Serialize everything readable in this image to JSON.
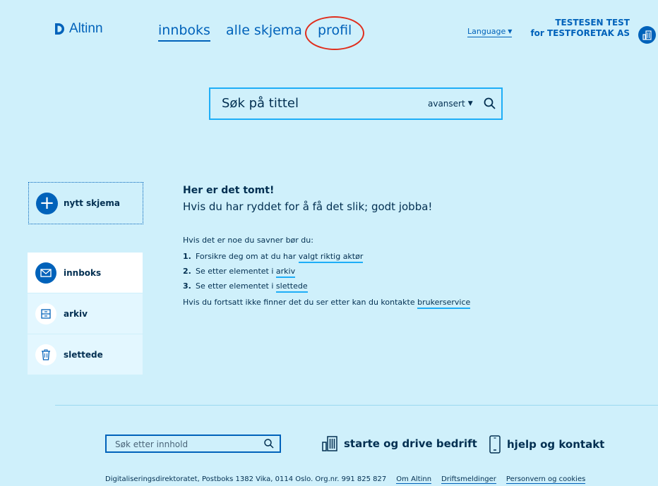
{
  "header": {
    "logo_text": "Altinn",
    "nav": [
      {
        "label": "innboks"
      },
      {
        "label": "alle skjema"
      },
      {
        "label": "profil"
      }
    ],
    "language_label": "Language",
    "user_name": "TESTESEN TEST",
    "user_org": "for TESTFORETAK AS"
  },
  "search": {
    "placeholder": "Søk på tittel",
    "advanced_label": "avansert"
  },
  "sidebar": {
    "new_form_label": "nytt skjema",
    "items": [
      {
        "label": "innboks",
        "icon": "envelope-icon"
      },
      {
        "label": "arkiv",
        "icon": "archive-icon"
      },
      {
        "label": "slettede",
        "icon": "trash-icon"
      }
    ]
  },
  "main": {
    "title": "Her er det tomt!",
    "subtitle": "Hvis du har ryddet for å få det slik; godt jobba!",
    "intro": "Hvis det er noe du savner bør du:",
    "steps": [
      {
        "num": "1.",
        "text": "Forsikre deg om at du har ",
        "link": "valgt riktig aktør"
      },
      {
        "num": "2.",
        "text": "Se etter elementet i ",
        "link": "arkiv"
      },
      {
        "num": "3.",
        "text": "Se etter elementet i ",
        "link": "slettede"
      }
    ],
    "outro_text": "Hvis du fortsatt ikke finner det du ser etter kan du kontakte ",
    "outro_link": "brukerservice"
  },
  "footer": {
    "search_placeholder": "Søk etter innhold",
    "link_business": "starte og drive bedrift",
    "link_help": "hjelp og kontakt",
    "address": "Digitaliseringsdirektoratet, Postboks 1382 Vika, 0114 Oslo. Org.nr. 991 825 827",
    "links": [
      "Om Altinn",
      "Driftsmeldinger",
      "Personvern og cookies"
    ]
  },
  "colors": {
    "background": "#cff0fb",
    "brand_blue": "#0062ba",
    "accent_cyan": "#1eaef7",
    "annotation_red": "#e02e1d"
  }
}
